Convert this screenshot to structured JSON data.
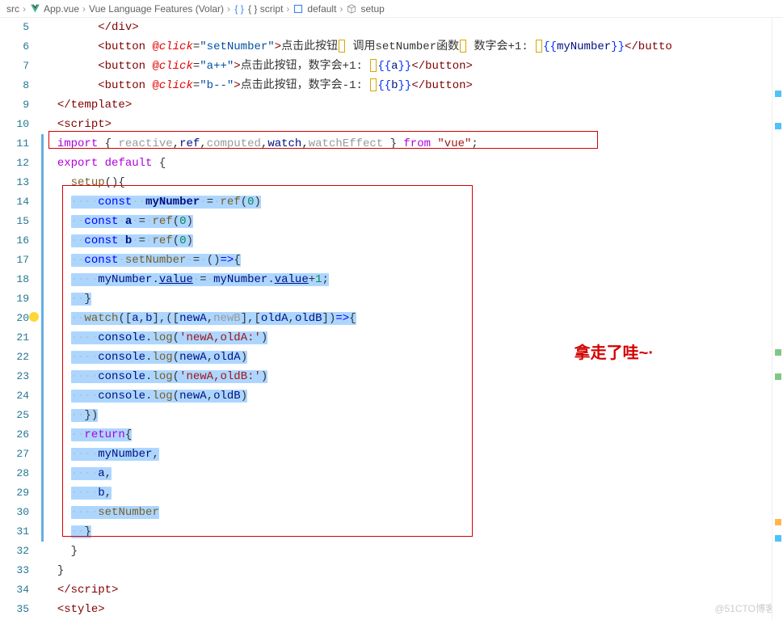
{
  "breadcrumb": [
    "src",
    "App.vue",
    "Vue Language Features (Volar)",
    "{ } script",
    "default",
    "setup"
  ],
  "annotation": "拿走了哇~·",
  "watermark": "@51CTO博客",
  "lines": [
    {
      "n": 5,
      "html": "        <span class='tag'>&lt;/div&gt;</span>"
    },
    {
      "n": 6,
      "html": "        <span class='tag'>&lt;button</span> <span class='attr'>@</span><span class='attr' style='font-style:italic'>click</span><span class='pun'>=</span><span class='attrval'>\"setNumber\"</span><span class='tag'>&gt;</span><span class='txt'>点击此按钮</span><span class='cbox'></span><span class='txt'> 调用setNumber函数</span><span class='cbox'></span><span class='txt'> 数字会+1</span><span class='pun'>:</span> <span class='cbox'></span><span class='brace'>{{</span><span class='interp'>myNumber</span><span class='brace'>}}</span><span class='tag'>&lt;/butto</span>"
    },
    {
      "n": 7,
      "html": "        <span class='tag'>&lt;button</span> <span class='attr'>@</span><span class='attr' style='font-style:italic'>click</span><span class='pun'>=</span><span class='attrval'>\"a++\"</span><span class='tag'>&gt;</span><span class='txt'>点击此按钮，数字会+1</span><span class='pun'>:</span> <span class='cbox'></span><span class='brace'>{{</span><span class='interp'>a</span><span class='brace'>}}</span><span class='tag'>&lt;/button&gt;</span>"
    },
    {
      "n": 8,
      "html": "        <span class='tag'>&lt;button</span> <span class='attr'>@</span><span class='attr' style='font-style:italic'>click</span><span class='pun'>=</span><span class='attrval'>\"b--\"</span><span class='tag'>&gt;</span><span class='txt'>点击此按钮，数字会-1</span><span class='pun'>:</span> <span class='cbox'></span><span class='brace'>{{</span><span class='interp'>b</span><span class='brace'>}}</span><span class='tag'>&lt;/button&gt;</span>"
    },
    {
      "n": 9,
      "html": "  <span class='tag'>&lt;/template&gt;</span>"
    },
    {
      "n": 10,
      "html": "  <span class='tag'>&lt;script&gt;</span>"
    },
    {
      "n": 11,
      "html": "  <span class='kw2'>import</span> <span class='pun'>{</span> <span class='dim'>reactive</span><span class='pun'>,</span><span class='var'>ref</span><span class='pun'>,</span><span class='dim'>computed</span><span class='pun'>,</span><span class='var'>watch</span><span class='pun'>,</span><span class='dim'>watchEffect</span> <span class='pun'>}</span> <span class='kw2'>from</span> <span class='str'>\"vue\"</span><span class='pun'>;</span>",
      "mod": true
    },
    {
      "n": 12,
      "html": "  <span class='kw2'>export</span> <span class='kw2'>default</span> <span class='pun'>{</span>",
      "mod": true
    },
    {
      "n": 13,
      "html": "    <span class='fn'>setup</span><span class='pun'>(){</span>",
      "mod": true
    },
    {
      "n": 14,
      "html": "    <span class='sel'><span class='ws'>·</span><span class='ws'>·</span><span class='ws'>·</span><span class='ws'>·</span><span class='kw'>const</span><span class='ws'>·</span><span class='ws'>·</span><span class='var2'>myNumber</span><span class='ws'>·</span>=<span class='ws'>·</span><span class='fn'>ref</span>(<span class='num'>0</span>)</span>",
      "mod": true
    },
    {
      "n": 15,
      "html": "    <span class='sel'><span class='ws'>·</span><span class='ws'>·</span><span class='kw'>const</span><span class='ws'>·</span><span class='var2'>a</span><span class='ws'>·</span>=<span class='ws'>·</span><span class='fn'>ref</span>(<span class='num'>0</span>)</span>",
      "mod": true
    },
    {
      "n": 16,
      "html": "    <span class='sel'><span class='ws'>·</span><span class='ws'>·</span><span class='kw'>const</span><span class='ws'>·</span><span class='var2'>b</span><span class='ws'>·</span>=<span class='ws'>·</span><span class='fn'>ref</span>(<span class='num'>0</span>)</span>",
      "mod": true
    },
    {
      "n": 17,
      "html": "    <span class='sel'><span class='ws'>·</span><span class='ws'>·</span><span class='kw'>const</span><span class='ws'>·</span><span class='fn'>setNumber</span><span class='ws'>·</span>=<span class='ws'>·</span>()<span class='kw'>=&gt;</span>{</span>",
      "mod": true
    },
    {
      "n": 18,
      "html": "    <span class='sel'><span class='ws'>·</span><span class='ws'>·</span><span class='ws'>·</span><span class='ws'>·</span><span class='var'>myNumber</span>.<span class='var ul'>value</span><span class='ws'>·</span>=<span class='ws'>·</span><span class='var'>myNumber</span>.<span class='var ul'>value</span>+<span class='num'>1</span>;</span>",
      "mod": true
    },
    {
      "n": 19,
      "html": "    <span class='sel'><span class='ws'>·</span><span class='ws'>·</span>}</span>",
      "mod": true
    },
    {
      "n": 20,
      "html": "    <span class='sel'><span class='ws'>·</span><span class='ws'>·</span><span class='fn'>watch</span>([<span class='var'>a</span>,<span class='var'>b</span>],([<span class='var'>newA</span>,<span class='dim'>newB</span>],[<span class='var'>oldA</span>,<span class='var'>oldB</span>])<span class='kw'>=&gt;</span>{</span>",
      "mod": true,
      "bulb": true
    },
    {
      "n": 21,
      "html": "    <span class='sel'><span class='ws'>·</span><span class='ws'>·</span><span class='ws'>·</span><span class='ws'>·</span><span class='var'>console</span>.<span class='fn'>log</span>(<span class='str'>'newA,oldA:'</span>)</span>",
      "mod": true
    },
    {
      "n": 22,
      "html": "    <span class='sel'><span class='ws'>·</span><span class='ws'>·</span><span class='ws'>·</span><span class='ws'>·</span><span class='var'>console</span>.<span class='fn'>log</span>(<span class='var'>newA</span>,<span class='var'>oldA</span>)</span>",
      "mod": true
    },
    {
      "n": 23,
      "html": "    <span class='sel'><span class='ws'>·</span><span class='ws'>·</span><span class='ws'>·</span><span class='ws'>·</span><span class='var'>console</span>.<span class='fn'>log</span>(<span class='str'>'newA,oldB:'</span>)</span>",
      "mod": true
    },
    {
      "n": 24,
      "html": "    <span class='sel'><span class='ws'>·</span><span class='ws'>·</span><span class='ws'>·</span><span class='ws'>·</span><span class='var'>console</span>.<span class='fn'>log</span>(<span class='var'>newA</span>,<span class='var'>oldB</span>)</span>",
      "mod": true
    },
    {
      "n": 25,
      "html": "    <span class='sel'><span class='ws'>·</span><span class='ws'>·</span>})</span>",
      "mod": true
    },
    {
      "n": 26,
      "html": "    <span class='sel'><span class='ws'>·</span><span class='ws'>·</span><span class='kw2'>return</span>{</span>",
      "mod": true
    },
    {
      "n": 27,
      "html": "    <span class='sel'><span class='ws'>·</span><span class='ws'>·</span><span class='ws'>·</span><span class='ws'>·</span><span class='var'>myNumber</span>,</span>",
      "mod": true
    },
    {
      "n": 28,
      "html": "    <span class='sel'><span class='ws'>·</span><span class='ws'>·</span><span class='ws'>·</span><span class='ws'>·</span><span class='var'>a</span>,</span>",
      "mod": true
    },
    {
      "n": 29,
      "html": "    <span class='sel'><span class='ws'>·</span><span class='ws'>·</span><span class='ws'>·</span><span class='ws'>·</span><span class='var'>b</span>,</span>",
      "mod": true
    },
    {
      "n": 30,
      "html": "    <span class='sel'><span class='ws'>·</span><span class='ws'>·</span><span class='ws'>·</span><span class='ws'>·</span><span class='fn'>setNumber</span></span>",
      "mod": true
    },
    {
      "n": 31,
      "html": "    <span class='sel'><span class='ws'>·</span><span class='ws'>·</span>}</span>",
      "mod": true
    },
    {
      "n": 32,
      "html": "    <span class='pun'>}</span>"
    },
    {
      "n": 33,
      "html": "  <span class='pun'>}</span>"
    },
    {
      "n": 34,
      "html": "  <span class='tag'>&lt;/script&gt;</span>"
    },
    {
      "n": 35,
      "html": "  <span class='tag'>&lt;style&gt;</span>"
    }
  ]
}
